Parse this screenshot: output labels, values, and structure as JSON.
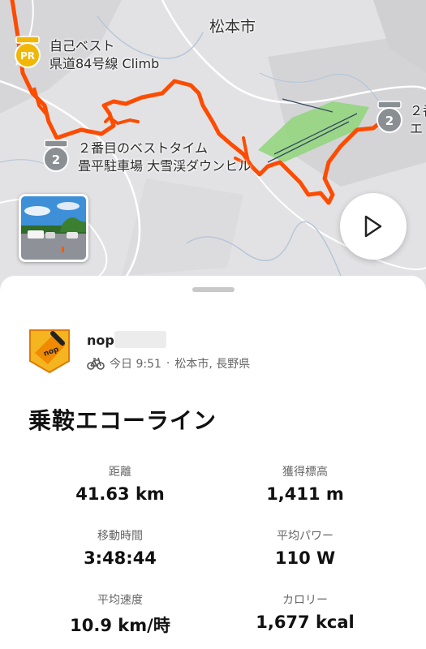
{
  "map": {
    "city_label": "松本市",
    "segments": [
      {
        "badge": "PR",
        "line1": "自己ベスト",
        "line2": "県道84号線 Climb"
      },
      {
        "badge": "2",
        "line1": "２番目のベストタイム",
        "line2": "畳平駐車場 大雪渓ダウンヒル"
      },
      {
        "badge": "2",
        "line1": "２番",
        "line2": "エ"
      }
    ],
    "route_color": "#fc4c02",
    "badge_gold": "#f2b705",
    "badge_gray": "#8a8f94"
  },
  "activity": {
    "athlete_name": "nop",
    "when": "今日 9:51",
    "location": "松本市, 長野県",
    "sport_icon": "bike-icon",
    "title": "乗鞍エコーライン"
  },
  "stats": {
    "distance": {
      "label": "距離",
      "value": "41.63 km"
    },
    "elevation": {
      "label": "獲得標高",
      "value": "1,411 m"
    },
    "moving_time": {
      "label": "移動時間",
      "value": "3:48:44"
    },
    "avg_power": {
      "label": "平均パワー",
      "value": "110 W"
    },
    "avg_speed": {
      "label": "平均速度",
      "value": "10.9 km/時"
    },
    "calories": {
      "label": "カロリー",
      "value": "1,677 kcal"
    }
  }
}
